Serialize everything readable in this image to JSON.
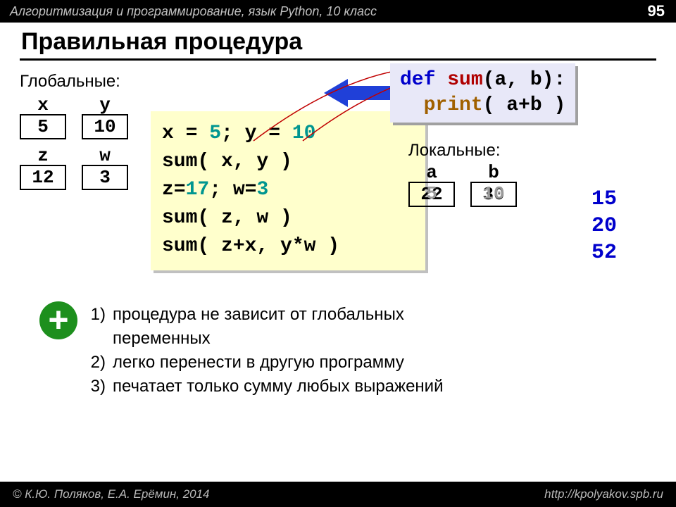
{
  "header": {
    "course": "Алгоритмизация и программирование, язык Python, 10 класс",
    "page": "95"
  },
  "title": "Правильная процедура",
  "globals": {
    "label": "Глобальные:",
    "vars": [
      {
        "name": "x",
        "value": "5"
      },
      {
        "name": "y",
        "value": "10"
      },
      {
        "name": "z",
        "value": "12"
      },
      {
        "name": "w",
        "value": "3"
      }
    ]
  },
  "code": {
    "l1_a": "x = ",
    "l1_b": "5",
    "l1_c": "; y = ",
    "l1_d": "10",
    "l2": "sum( x, y )",
    "l3_a": "z=",
    "l3_b": "17",
    "l3_c": "; w=",
    "l3_d": "3",
    "l4": "sum( z, w )",
    "l5": "sum( z+x, y*w )"
  },
  "defblock": {
    "def": "def",
    "sum": "sum",
    "sig": "(a, b):",
    "indent_print": "print",
    "args": "( a+b )"
  },
  "locals": {
    "label": "Локальные:",
    "a_name": "a",
    "b_name": "b",
    "a_gray": "5",
    "b_gray": "10",
    "a_main": "22",
    "b_main": "30"
  },
  "results": {
    "r1": "15",
    "r2": "20",
    "r3": "52"
  },
  "advantages": {
    "n1": "1)",
    "t1a": "процедура не зависит от глобальных",
    "t1b": "переменных",
    "n2": "2)",
    "t2": "легко перенести в другую программу",
    "n3": "3)",
    "t3": "печатает только сумму любых выражений"
  },
  "footer": {
    "authors": "© К.Ю. Поляков, Е.А. Ерёмин, 2014",
    "url": "http://kpolyakov.spb.ru"
  },
  "icons": {
    "plus": "+"
  }
}
